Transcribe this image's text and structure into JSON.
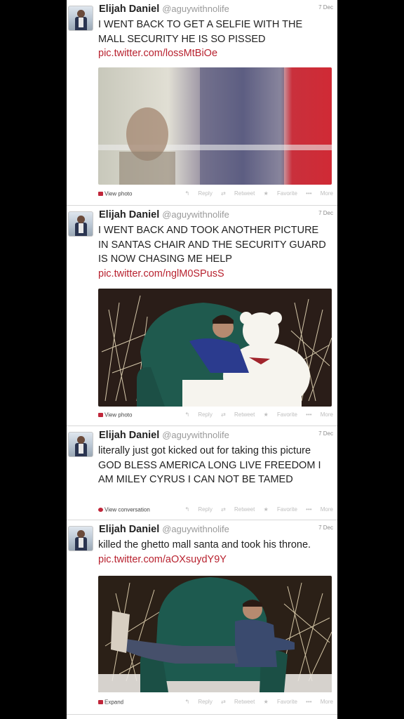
{
  "tweets": [
    {
      "name": "Elijah Daniel",
      "handle": "@aguywithnolife",
      "date": "7 Dec",
      "text": "I WENT BACK TO GET A SELFIE WITH THE MALL SECURITY HE IS SO PISSED",
      "link": "pic.twitter.com/lossMtBiOe",
      "footer_link": "View photo",
      "actions": {
        "reply": "Reply",
        "retweet": "Retweet",
        "favorite": "Favorite",
        "more": "More"
      }
    },
    {
      "name": "Elijah Daniel",
      "handle": "@aguywithnolife",
      "date": "7 Dec",
      "text": "I WENT BACK AND TOOK ANOTHER PICTURE IN SANTAS CHAIR AND THE SECURITY GUARD IS NOW CHASING ME HELP",
      "link": "pic.twitter.com/nglM0SPusS",
      "footer_link": "View photo",
      "actions": {
        "reply": "Reply",
        "retweet": "Retweet",
        "favorite": "Favorite",
        "more": "More"
      }
    },
    {
      "name": "Elijah Daniel",
      "handle": "@aguywithnolife",
      "date": "7 Dec",
      "text": "literally just got kicked out for taking this picture GOD BLESS AMERICA LONG LIVE FREEDOM I AM MILEY CYRUS I CAN NOT BE TAMED",
      "link": "",
      "footer_link": "View conversation",
      "actions": {
        "reply": "Reply",
        "retweet": "Retweet",
        "favorite": "Favorite",
        "more": "More"
      }
    },
    {
      "name": "Elijah Daniel",
      "handle": "@aguywithnolife",
      "date": "7 Dec",
      "text": "killed the ghetto mall santa and took his throne.",
      "link": "pic.twitter.com/aOXsuydY9Y",
      "footer_link": "Expand",
      "actions": {
        "reply": "Reply",
        "retweet": "Retweet",
        "favorite": "Favorite",
        "more": "More"
      }
    }
  ],
  "colors": {
    "link": "#b8222f",
    "accent": "#c0263a",
    "background": "#000000"
  },
  "icons": {
    "view": "photo-icon",
    "reply": "reply-icon",
    "retweet": "retweet-icon",
    "favorite": "star-icon",
    "more": "more-dots-icon"
  }
}
